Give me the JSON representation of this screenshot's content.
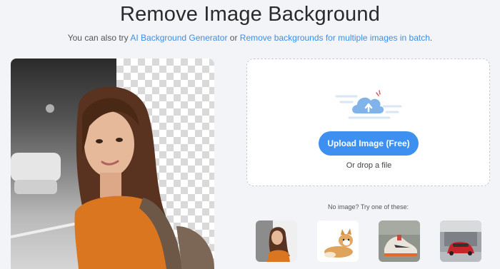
{
  "page": {
    "title": "Remove Image Background",
    "subtitle_prefix": "You can also try ",
    "link_ai": "AI Background Generator",
    "subtitle_mid": " or ",
    "link_batch": "Remove backgrounds for multiple images in batch",
    "subtitle_suffix": "."
  },
  "upload": {
    "button_label": "Upload Image (Free)",
    "drop_text": "Or drop a file"
  },
  "samples": {
    "label": "No image? Try one of these:",
    "items": [
      {
        "icon": "woman-photo-icon"
      },
      {
        "icon": "dog-photo-icon"
      },
      {
        "icon": "sneaker-photo-icon"
      },
      {
        "icon": "car-photo-icon"
      }
    ]
  },
  "colors": {
    "accent": "#3d8ff0",
    "link": "#3b8ee8",
    "background": "#f3f4f8"
  }
}
